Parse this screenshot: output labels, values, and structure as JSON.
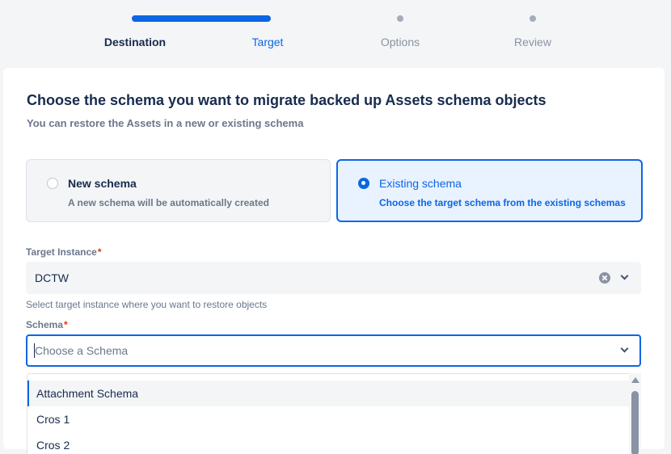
{
  "stepper": {
    "steps": [
      {
        "label": "Destination",
        "state": "done"
      },
      {
        "label": "Target",
        "state": "current"
      },
      {
        "label": "Options",
        "state": "todo"
      },
      {
        "label": "Review",
        "state": "todo"
      }
    ]
  },
  "card": {
    "heading": "Choose the schema you want to migrate backed up Assets schema objects",
    "subheading": "You can restore the Assets in a new or existing schema"
  },
  "schema_type": {
    "options": [
      {
        "title": "New schema",
        "description": "A new schema will be automatically created",
        "selected": false
      },
      {
        "title": "Existing schema",
        "description": "Choose the target schema from the existing schemas",
        "selected": true
      }
    ]
  },
  "target_instance": {
    "label": "Target Instance",
    "required_mark": "*",
    "value": "DCTW",
    "helper": "Select target instance where you want to restore objects"
  },
  "schema": {
    "label": "Schema",
    "required_mark": "*",
    "placeholder": "Choose a Schema",
    "options": [
      "Attachment Schema",
      "Cros 1",
      "Cros 2"
    ]
  },
  "colors": {
    "accent": "#0c66e4",
    "required": "#de350b",
    "subtle_text": "#6b778c"
  }
}
